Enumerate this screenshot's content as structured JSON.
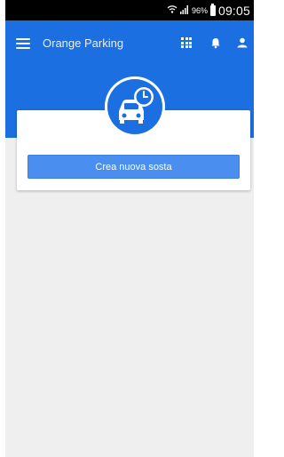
{
  "status_bar": {
    "signal_percent": "96%",
    "time": "09:05"
  },
  "app_bar": {
    "title": "Orange Parking",
    "icons": [
      "menu-icon",
      "grid-icon",
      "bell-icon",
      "person-icon"
    ]
  },
  "hero": {
    "icon": "car-clock-icon"
  },
  "card": {
    "button_label": "Crea nuova sosta"
  },
  "colors": {
    "primary": "#1c6fe0",
    "button": "#4a8ef0",
    "background": "#efefef"
  }
}
